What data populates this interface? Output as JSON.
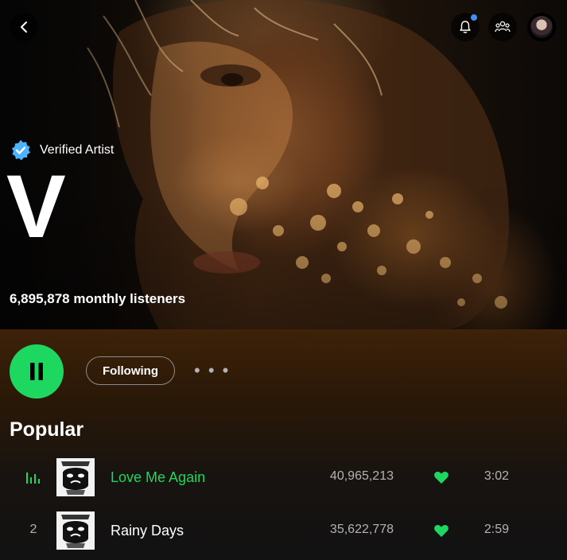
{
  "header": {
    "back_icon": "chevron-left-icon",
    "notifications_icon": "bell-icon",
    "notification_dot_color": "#3d91f4",
    "friends_icon": "friends-activity-icon",
    "avatar_icon": "user-avatar"
  },
  "artist": {
    "verified_label": "Verified Artist",
    "verified_badge_color": "#4cb3ff",
    "name": "V",
    "monthly_listeners": "6,895,878 monthly listeners"
  },
  "actions": {
    "play_icon": "pause-icon",
    "play_button_color": "#1ed760",
    "follow_label": "Following",
    "more_label": "• • •"
  },
  "popular": {
    "heading": "Popular",
    "accent_color": "#1ed760",
    "tracks": [
      {
        "rank": "",
        "playing": true,
        "title": "Love Me Again",
        "plays": "40,965,213",
        "liked": true,
        "duration": "3:02"
      },
      {
        "rank": "2",
        "playing": false,
        "title": "Rainy Days",
        "plays": "35,622,778",
        "liked": true,
        "duration": "2:59"
      }
    ]
  }
}
